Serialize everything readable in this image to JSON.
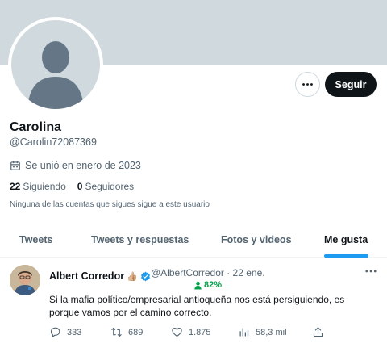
{
  "profile": {
    "name": "Carolina",
    "handle": "@Carolin72087369",
    "joined": "Se unió en enero de 2023",
    "following_count": "22",
    "following_label": "Siguiendo",
    "followers_count": "0",
    "followers_label": "Seguidores",
    "followed_by": "Ninguna de las cuentas que sigues sigue a este usuario"
  },
  "actions": {
    "follow_label": "Seguir",
    "more_icon": "more-horizontal-icon"
  },
  "tabs": [
    {
      "label": "Tweets",
      "active": false
    },
    {
      "label": "Tweets y respuestas",
      "active": false
    },
    {
      "label": "Fotos y videos",
      "active": false
    },
    {
      "label": "Me gusta",
      "active": true
    }
  ],
  "tweet": {
    "author_name": "Albert Corredor",
    "author_emoji": "👍🏼",
    "handle_time": "@AlbertCorredor · 22 ene.",
    "percent": "82%",
    "text": "Si la mafia político/empresarial antioqueña nos está persiguiendo, es porque vamos por el camino correcto.",
    "replies": "333",
    "retweets": "689",
    "likes": "1.875",
    "views": "58,3 mil"
  },
  "colors": {
    "banner": "#cfd9de",
    "accent": "#1d9bf0",
    "follow_bg": "#0f1419",
    "percent_green": "#00a34a"
  }
}
